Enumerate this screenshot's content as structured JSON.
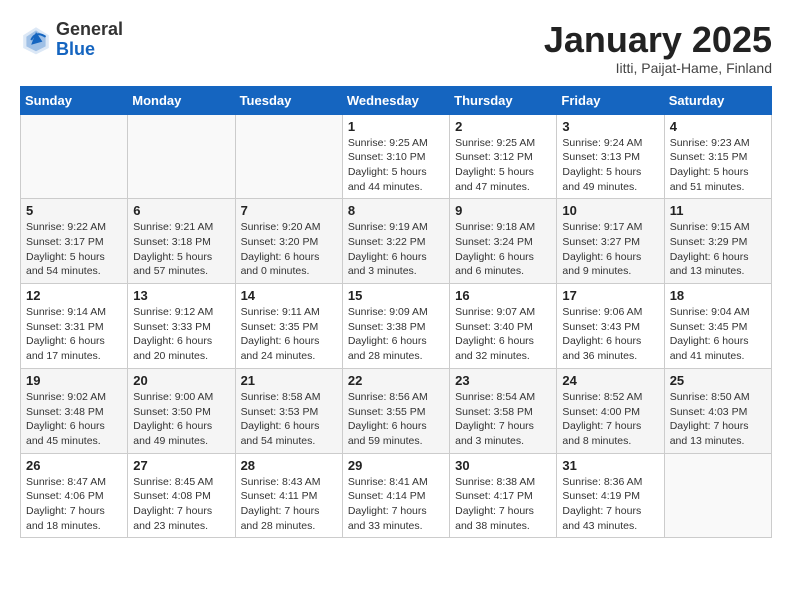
{
  "logo": {
    "general": "General",
    "blue": "Blue"
  },
  "title": {
    "month_year": "January 2025",
    "location": "Iitti, Paijat-Hame, Finland"
  },
  "weekdays": [
    "Sunday",
    "Monday",
    "Tuesday",
    "Wednesday",
    "Thursday",
    "Friday",
    "Saturday"
  ],
  "weeks": [
    [
      {
        "day": "",
        "detail": ""
      },
      {
        "day": "",
        "detail": ""
      },
      {
        "day": "",
        "detail": ""
      },
      {
        "day": "1",
        "detail": "Sunrise: 9:25 AM\nSunset: 3:10 PM\nDaylight: 5 hours\nand 44 minutes."
      },
      {
        "day": "2",
        "detail": "Sunrise: 9:25 AM\nSunset: 3:12 PM\nDaylight: 5 hours\nand 47 minutes."
      },
      {
        "day": "3",
        "detail": "Sunrise: 9:24 AM\nSunset: 3:13 PM\nDaylight: 5 hours\nand 49 minutes."
      },
      {
        "day": "4",
        "detail": "Sunrise: 9:23 AM\nSunset: 3:15 PM\nDaylight: 5 hours\nand 51 minutes."
      }
    ],
    [
      {
        "day": "5",
        "detail": "Sunrise: 9:22 AM\nSunset: 3:17 PM\nDaylight: 5 hours\nand 54 minutes."
      },
      {
        "day": "6",
        "detail": "Sunrise: 9:21 AM\nSunset: 3:18 PM\nDaylight: 5 hours\nand 57 minutes."
      },
      {
        "day": "7",
        "detail": "Sunrise: 9:20 AM\nSunset: 3:20 PM\nDaylight: 6 hours\nand 0 minutes."
      },
      {
        "day": "8",
        "detail": "Sunrise: 9:19 AM\nSunset: 3:22 PM\nDaylight: 6 hours\nand 3 minutes."
      },
      {
        "day": "9",
        "detail": "Sunrise: 9:18 AM\nSunset: 3:24 PM\nDaylight: 6 hours\nand 6 minutes."
      },
      {
        "day": "10",
        "detail": "Sunrise: 9:17 AM\nSunset: 3:27 PM\nDaylight: 6 hours\nand 9 minutes."
      },
      {
        "day": "11",
        "detail": "Sunrise: 9:15 AM\nSunset: 3:29 PM\nDaylight: 6 hours\nand 13 minutes."
      }
    ],
    [
      {
        "day": "12",
        "detail": "Sunrise: 9:14 AM\nSunset: 3:31 PM\nDaylight: 6 hours\nand 17 minutes."
      },
      {
        "day": "13",
        "detail": "Sunrise: 9:12 AM\nSunset: 3:33 PM\nDaylight: 6 hours\nand 20 minutes."
      },
      {
        "day": "14",
        "detail": "Sunrise: 9:11 AM\nSunset: 3:35 PM\nDaylight: 6 hours\nand 24 minutes."
      },
      {
        "day": "15",
        "detail": "Sunrise: 9:09 AM\nSunset: 3:38 PM\nDaylight: 6 hours\nand 28 minutes."
      },
      {
        "day": "16",
        "detail": "Sunrise: 9:07 AM\nSunset: 3:40 PM\nDaylight: 6 hours\nand 32 minutes."
      },
      {
        "day": "17",
        "detail": "Sunrise: 9:06 AM\nSunset: 3:43 PM\nDaylight: 6 hours\nand 36 minutes."
      },
      {
        "day": "18",
        "detail": "Sunrise: 9:04 AM\nSunset: 3:45 PM\nDaylight: 6 hours\nand 41 minutes."
      }
    ],
    [
      {
        "day": "19",
        "detail": "Sunrise: 9:02 AM\nSunset: 3:48 PM\nDaylight: 6 hours\nand 45 minutes."
      },
      {
        "day": "20",
        "detail": "Sunrise: 9:00 AM\nSunset: 3:50 PM\nDaylight: 6 hours\nand 49 minutes."
      },
      {
        "day": "21",
        "detail": "Sunrise: 8:58 AM\nSunset: 3:53 PM\nDaylight: 6 hours\nand 54 minutes."
      },
      {
        "day": "22",
        "detail": "Sunrise: 8:56 AM\nSunset: 3:55 PM\nDaylight: 6 hours\nand 59 minutes."
      },
      {
        "day": "23",
        "detail": "Sunrise: 8:54 AM\nSunset: 3:58 PM\nDaylight: 7 hours\nand 3 minutes."
      },
      {
        "day": "24",
        "detail": "Sunrise: 8:52 AM\nSunset: 4:00 PM\nDaylight: 7 hours\nand 8 minutes."
      },
      {
        "day": "25",
        "detail": "Sunrise: 8:50 AM\nSunset: 4:03 PM\nDaylight: 7 hours\nand 13 minutes."
      }
    ],
    [
      {
        "day": "26",
        "detail": "Sunrise: 8:47 AM\nSunset: 4:06 PM\nDaylight: 7 hours\nand 18 minutes."
      },
      {
        "day": "27",
        "detail": "Sunrise: 8:45 AM\nSunset: 4:08 PM\nDaylight: 7 hours\nand 23 minutes."
      },
      {
        "day": "28",
        "detail": "Sunrise: 8:43 AM\nSunset: 4:11 PM\nDaylight: 7 hours\nand 28 minutes."
      },
      {
        "day": "29",
        "detail": "Sunrise: 8:41 AM\nSunset: 4:14 PM\nDaylight: 7 hours\nand 33 minutes."
      },
      {
        "day": "30",
        "detail": "Sunrise: 8:38 AM\nSunset: 4:17 PM\nDaylight: 7 hours\nand 38 minutes."
      },
      {
        "day": "31",
        "detail": "Sunrise: 8:36 AM\nSunset: 4:19 PM\nDaylight: 7 hours\nand 43 minutes."
      },
      {
        "day": "",
        "detail": ""
      }
    ]
  ]
}
